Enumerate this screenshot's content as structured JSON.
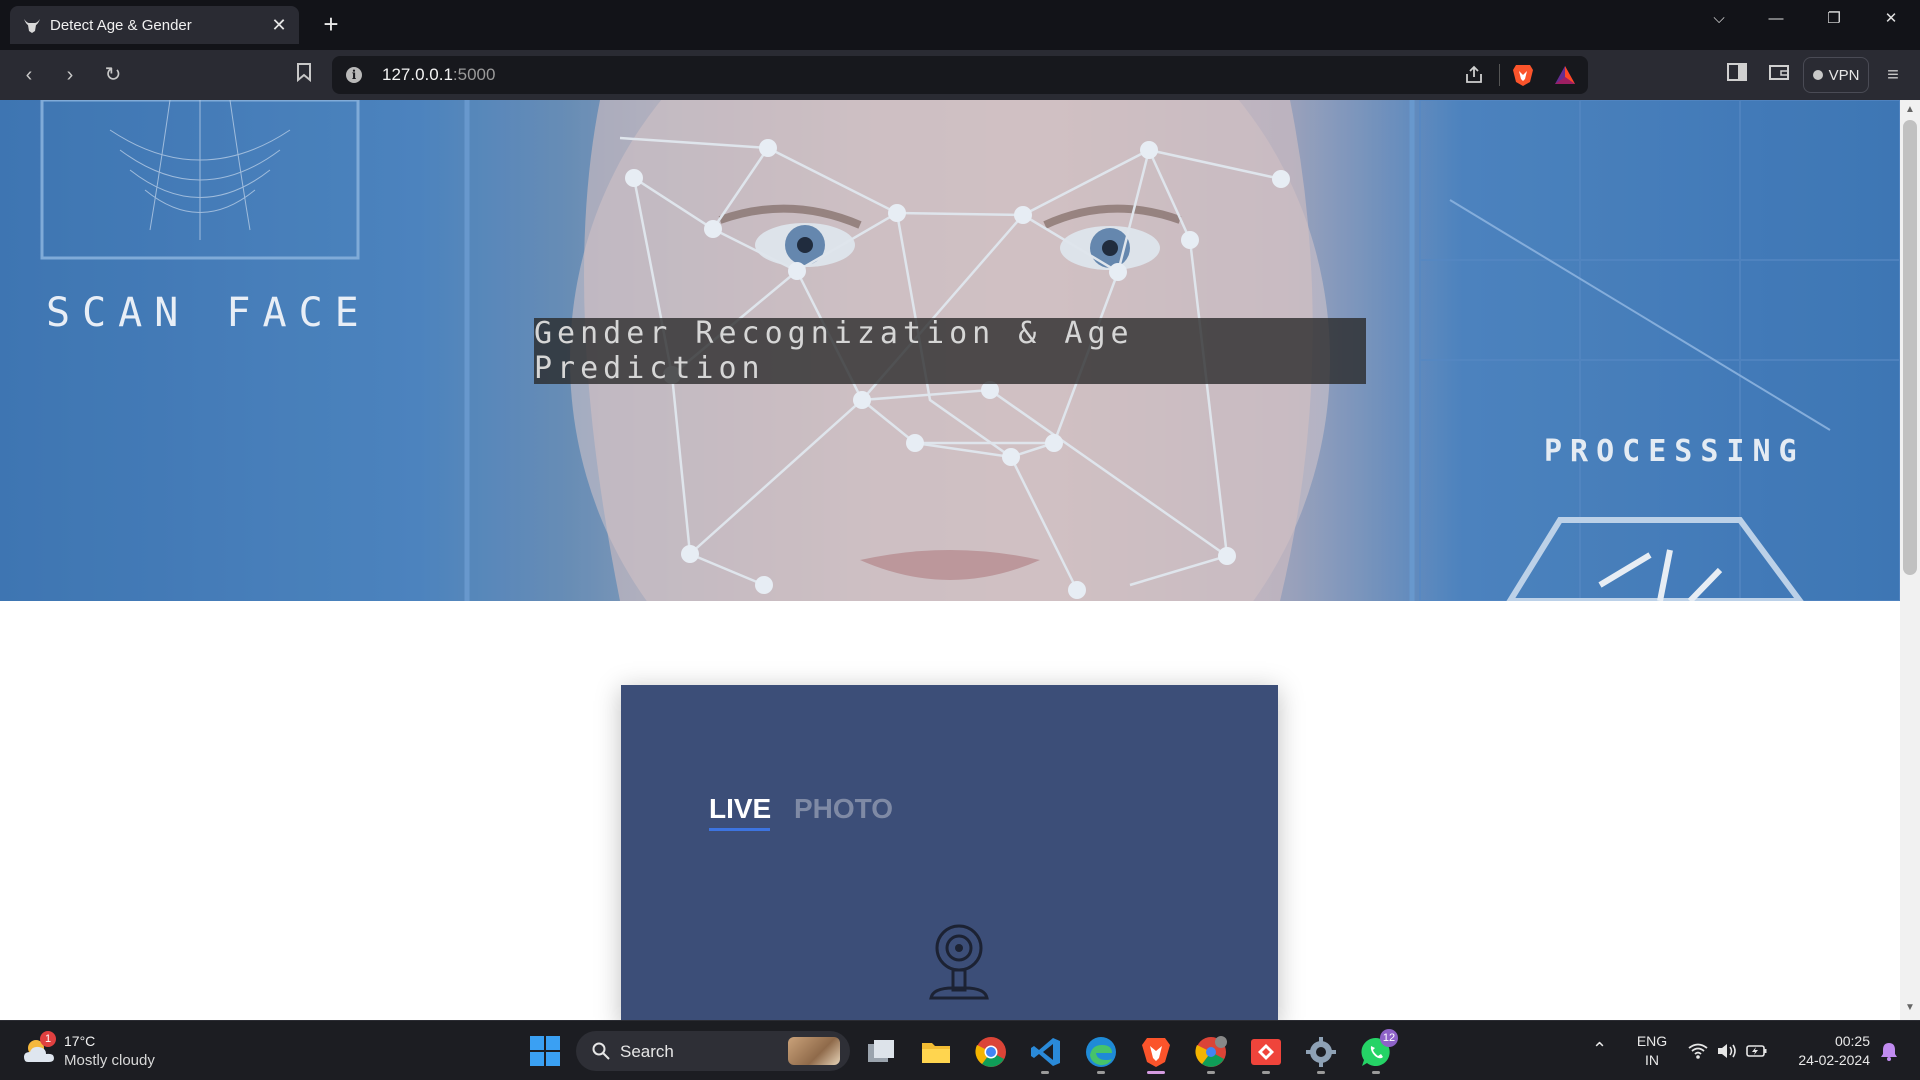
{
  "browser": {
    "tab_title": "Detect Age & Gender",
    "url_host": "127.0.0.1",
    "url_port": ":5000",
    "vpn_label": "VPN",
    "new_tab": "+",
    "close_tab": "✕"
  },
  "hero": {
    "scan_text": "SCAN FACE",
    "title": "Gender Recognization & Age Prediction",
    "processing_text": "PROCESSING"
  },
  "card": {
    "tabs": [
      {
        "label": "LIVE",
        "active": true
      },
      {
        "label": "PHOTO",
        "active": false
      }
    ],
    "camera_icon": "webcam-icon"
  },
  "taskbar": {
    "weather_temp": "17°C",
    "weather_condition": "Mostly cloudy",
    "weather_badge": "1",
    "search_label": "Search",
    "whatsapp_badge": "12",
    "language": "ENG",
    "region": "IN",
    "time": "00:25",
    "date": "24-02-2024"
  },
  "colors": {
    "card_bg": "#3c4e78",
    "tab_active": "#ffffff",
    "tab_inactive": "#7f8aa5",
    "tab_underline": "#3d74e0",
    "hero_title_bg": "#282828"
  }
}
